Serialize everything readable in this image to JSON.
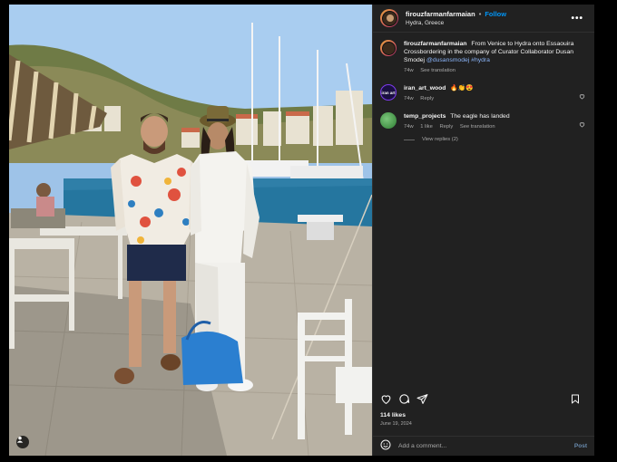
{
  "post": {
    "username": "firouzfarmanfarmaian",
    "separator": "•",
    "follow_label": "Follow",
    "location": "Hydra, Greece",
    "more_label": "•••"
  },
  "caption": {
    "username": "firouzfarmanfarmaian",
    "text": "From Venice to Hydra onto Essaouira Crossbordering in the company of Curator Collaborator Dusan Smodej",
    "mention": "@dusansmodej",
    "hashtag": "#hydra",
    "age": "74w",
    "see_translation": "See translation"
  },
  "comments": [
    {
      "username": "iran_art_wood",
      "text": "🔥👏😍",
      "age": "74w",
      "reply_label": "Reply",
      "avatar_text": "iran art"
    },
    {
      "username": "temp_projects",
      "text": "The eagle has landed",
      "age": "74w",
      "likes": "1 like",
      "reply_label": "Reply",
      "see_translation": "See translation",
      "view_replies": "View replies (2)"
    }
  ],
  "footer": {
    "likes": "114 likes",
    "date": "June 19, 2024",
    "comment_placeholder": "Add a comment...",
    "post_label": "Post"
  },
  "icons": {
    "like": "heart-icon",
    "comment": "comment-icon",
    "share": "share-icon",
    "save": "bookmark-icon",
    "emoji": "emoji-icon",
    "tag": "user-tag-icon"
  },
  "colors": {
    "link": "#0095f6",
    "panel_bg": "#212121",
    "text": "#f5f5f5",
    "muted": "#a8a8a8"
  }
}
